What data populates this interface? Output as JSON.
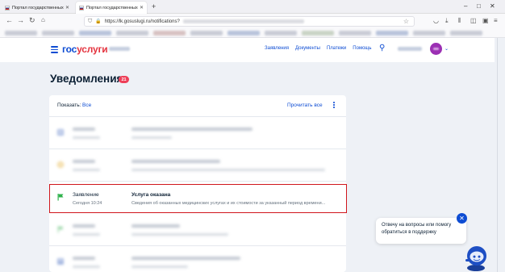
{
  "browser": {
    "tabs": [
      {
        "title": "Портал государственных усл..."
      },
      {
        "title": "Портал государственных услуг Р..."
      }
    ],
    "new_tab_symbol": "+",
    "url": "https://lk.gosuslugi.ru/notifications?"
  },
  "header": {
    "logo_part1": "гос",
    "logo_part2": "услуги",
    "nav": [
      "Заявления",
      "Документы",
      "Платежи",
      "Помощь"
    ]
  },
  "main": {
    "title": "Уведомления",
    "badge_count": "21",
    "filter_label": "Показать:",
    "filter_value": "Все",
    "read_all": "Прочитать все",
    "notifications": [
      {
        "type": "Заявление",
        "time": "Сегодня 10:24",
        "title": "Услуга оказана",
        "description": "Сведения об оказанных медицинских услугах и их стоимости за указанный период времени..."
      }
    ]
  },
  "chat": {
    "text": "Отвечу на вопросы или помогу обратиться в поддержку"
  },
  "colors": {
    "brand_blue": "#0d4cd3",
    "brand_red": "#e4343f",
    "badge": "#ee3f58",
    "highlight": "#d0161c",
    "status_green": "#2fb24c"
  }
}
